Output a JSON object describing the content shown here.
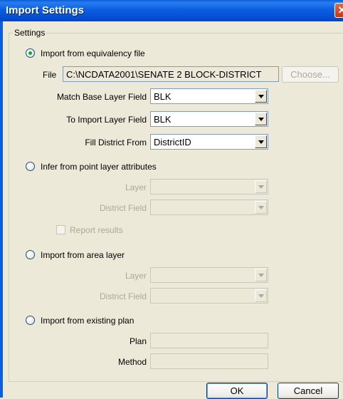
{
  "window": {
    "title": "Import Settings",
    "close_glyph": "✕"
  },
  "settings": {
    "legend": "Settings",
    "opt_equivalency": {
      "label": "Import from equivalency file",
      "selected": true,
      "file_label": "File",
      "file_value": "C:\\NCDATA2001\\SENATE 2 BLOCK-DISTRICT",
      "choose_label": "Choose...",
      "match_label": "Match Base Layer Field",
      "match_value": "BLK",
      "to_import_label": "To Import Layer Field",
      "to_import_value": "BLK",
      "fill_label": "Fill District From",
      "fill_value": "DistrictID"
    },
    "opt_point": {
      "label": "Infer from point layer attributes",
      "selected": false,
      "layer_label": "Layer",
      "layer_value": "",
      "district_label": "District Field",
      "district_value": "",
      "report_label": "Report results",
      "report_checked": false
    },
    "opt_area": {
      "label": "Import from area layer",
      "selected": false,
      "layer_label": "Layer",
      "layer_value": "",
      "district_label": "District Field",
      "district_value": ""
    },
    "opt_plan": {
      "label": "Import from existing plan",
      "selected": false,
      "plan_label": "Plan",
      "plan_value": "",
      "method_label": "Method",
      "method_value": ""
    }
  },
  "buttons": {
    "ok": "OK",
    "cancel": "Cancel"
  },
  "colors": {
    "titlebar": "#0a5fd8",
    "window_bg": "#ece9d8",
    "radio_dot": "#21a121"
  }
}
